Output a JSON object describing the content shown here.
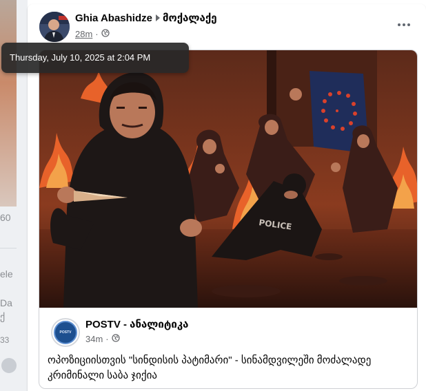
{
  "background": {
    "fragments": [
      "60",
      "ele",
      "Da",
      "ქ",
      "33"
    ]
  },
  "post": {
    "author": "Ghia Abashidze",
    "target": "მოქალაქე",
    "timestamp": "28m",
    "audience_icon": "globe-icon",
    "tooltip": "Thursday, July 10, 2025 at 2:04 PM"
  },
  "shared": {
    "page_name": "POSTV - ანალიტიკა",
    "timestamp": "34m",
    "audience_icon": "globe-icon",
    "text": "ოპოზიციისთვის \"სინდისის პატიმარი\" - სინამდვილეში მოძალადე კრიმინალი საბა ჯიქია",
    "image_label": "POLICE"
  },
  "colors": {
    "secondary_text": "#65676b",
    "flame": "#e8622a",
    "eu_flag": "#1f2d5a",
    "stars": "#d9412b"
  }
}
